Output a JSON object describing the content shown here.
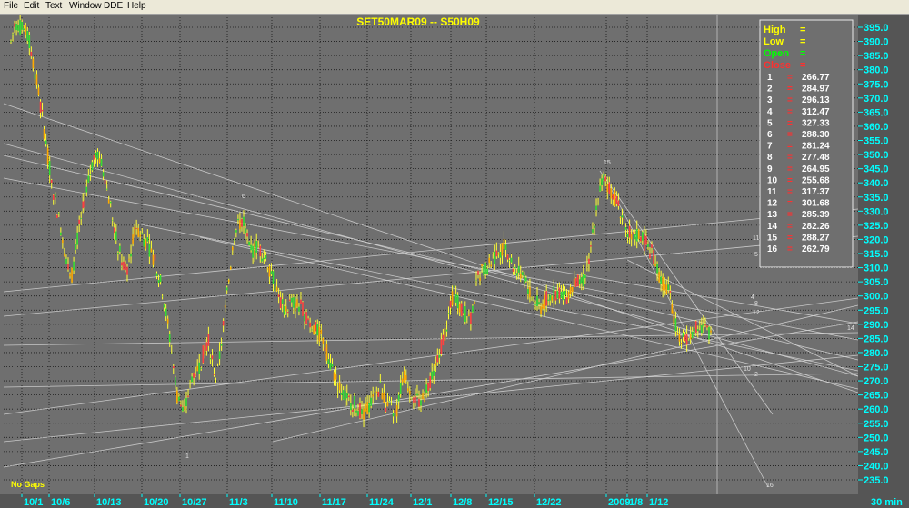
{
  "menu": [
    "File",
    "Edit",
    "Text",
    "Window",
    "DDE",
    "Help"
  ],
  "chart_data": {
    "type": "candlestick",
    "title": "SET50MAR09  --  S50H09",
    "bottom_left_note": "No  Gaps",
    "x_unit": "30  min",
    "x_ticks": [
      "10/1",
      "10/6",
      "10/13",
      "10/20",
      "10/27",
      "11/3",
      "11/10",
      "11/17",
      "11/24",
      "12/1",
      "12/8",
      "12/15",
      "12/22",
      "2009",
      "1/8",
      "1/12"
    ],
    "ylim": [
      235,
      398
    ],
    "y_ticks": [
      235,
      240,
      245,
      250,
      255,
      260,
      265,
      270,
      275,
      280,
      285,
      290,
      295,
      300,
      305,
      310,
      315,
      320,
      325,
      330,
      335,
      340,
      345,
      350,
      355,
      360,
      365,
      370,
      375,
      380,
      385,
      390,
      395
    ],
    "legend": {
      "labels": [
        {
          "name": "High",
          "color": "#ffff00"
        },
        {
          "name": "Low",
          "color": "#ffff00"
        },
        {
          "name": "Open",
          "color": "#00ff00"
        },
        {
          "name": "Close",
          "color": "#ff3030"
        }
      ],
      "levels": [
        {
          "n": "1",
          "value": "266.77"
        },
        {
          "n": "2",
          "value": "284.97"
        },
        {
          "n": "3",
          "value": "296.13"
        },
        {
          "n": "4",
          "value": "312.47"
        },
        {
          "n": "5",
          "value": "327.33"
        },
        {
          "n": "6",
          "value": "288.30"
        },
        {
          "n": "7",
          "value": "281.24"
        },
        {
          "n": "8",
          "value": "277.48"
        },
        {
          "n": "9",
          "value": "264.95"
        },
        {
          "n": "10",
          "value": "255.68"
        },
        {
          "n": "11",
          "value": "317.37"
        },
        {
          "n": "12",
          "value": "301.68"
        },
        {
          "n": "13",
          "value": "285.39"
        },
        {
          "n": "14",
          "value": "282.26"
        },
        {
          "n": "15",
          "value": "288.27"
        },
        {
          "n": "16",
          "value": "262.79"
        }
      ]
    },
    "trend_labels": [
      "1",
      "2",
      "4",
      "5",
      "6",
      "8",
      "10",
      "11",
      "12",
      "14",
      "15",
      "16"
    ],
    "price_path": [
      [
        0,
        390
      ],
      [
        0.3,
        397
      ],
      [
        1.2,
        392
      ],
      [
        1.8,
        375
      ],
      [
        2.3,
        358
      ],
      [
        2.8,
        340
      ],
      [
        3.5,
        322
      ],
      [
        4.1,
        305
      ],
      [
        4.7,
        325
      ],
      [
        5.3,
        340
      ],
      [
        5.8,
        352
      ],
      [
        6.3,
        345
      ],
      [
        6.9,
        330
      ],
      [
        7.3,
        318
      ],
      [
        7.9,
        308
      ],
      [
        8.6,
        325
      ],
      [
        9.4,
        318
      ],
      [
        9.9,
        312
      ],
      [
        10.4,
        302
      ],
      [
        10.9,
        285
      ],
      [
        11.4,
        265
      ],
      [
        11.9,
        258
      ],
      [
        12.4,
        272
      ],
      [
        12.9,
        275
      ],
      [
        13.5,
        285
      ],
      [
        14.1,
        270
      ],
      [
        14.7,
        295
      ],
      [
        15.3,
        322
      ],
      [
        15.9,
        328
      ],
      [
        16.4,
        315
      ],
      [
        16.9,
        318
      ],
      [
        17.6,
        312
      ],
      [
        18.2,
        303
      ],
      [
        18.7,
        295
      ],
      [
        19.3,
        298
      ],
      [
        19.9,
        296
      ],
      [
        20.6,
        290
      ],
      [
        21.4,
        285
      ],
      [
        21.9,
        276
      ],
      [
        22.5,
        268
      ],
      [
        23.1,
        263
      ],
      [
        23.6,
        262
      ],
      [
        24.2,
        258
      ],
      [
        24.7,
        262
      ],
      [
        25.3,
        268
      ],
      [
        25.8,
        261
      ],
      [
        26.4,
        258
      ],
      [
        26.9,
        272
      ],
      [
        27.5,
        266
      ],
      [
        28.1,
        262
      ],
      [
        28.7,
        270
      ],
      [
        29.3,
        278
      ],
      [
        29.9,
        290
      ],
      [
        30.4,
        302
      ],
      [
        30.9,
        295
      ],
      [
        31.5,
        292
      ],
      [
        32.1,
        308
      ],
      [
        32.7,
        310
      ],
      [
        33.3,
        315
      ],
      [
        33.9,
        318
      ],
      [
        34.5,
        310
      ],
      [
        35.1,
        308
      ],
      [
        35.7,
        300
      ],
      [
        36.3,
        296
      ],
      [
        36.9,
        300
      ],
      [
        37.5,
        302
      ],
      [
        38.1,
        300
      ],
      [
        38.7,
        305
      ],
      [
        39.2,
        304
      ],
      [
        39.7,
        315
      ],
      [
        40.1,
        330
      ],
      [
        40.6,
        342
      ],
      [
        41.1,
        338
      ],
      [
        41.6,
        333
      ],
      [
        42.1,
        326
      ],
      [
        42.6,
        320
      ],
      [
        43.1,
        322
      ],
      [
        43.6,
        318
      ],
      [
        44.1,
        314
      ],
      [
        44.6,
        305
      ],
      [
        45.1,
        302
      ],
      [
        45.5,
        292
      ],
      [
        46.0,
        284
      ],
      [
        46.5,
        286
      ],
      [
        47.0,
        290
      ],
      [
        47.5,
        289
      ],
      [
        48,
        286
      ]
    ]
  }
}
